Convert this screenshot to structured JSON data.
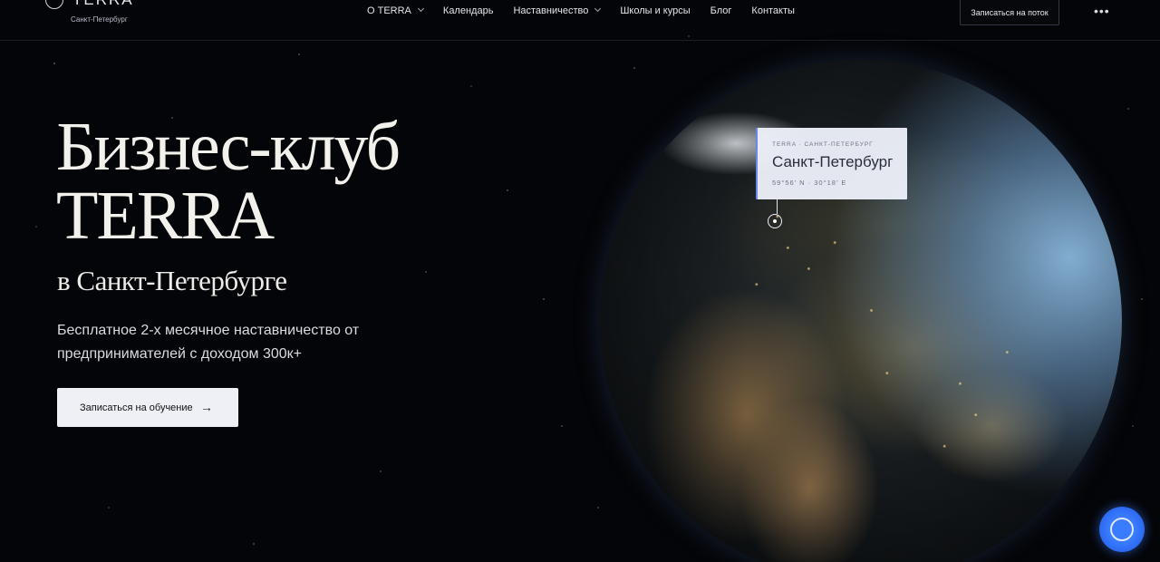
{
  "header": {
    "logo_text": "TERRA",
    "logo_sub": "Санкт-Петербург",
    "nav": [
      {
        "label": "О TERRA",
        "has_dropdown": true
      },
      {
        "label": "Календарь",
        "has_dropdown": false
      },
      {
        "label": "Наставничество",
        "has_dropdown": true
      },
      {
        "label": "Школы и курсы",
        "has_dropdown": false
      },
      {
        "label": "Блог",
        "has_dropdown": false
      },
      {
        "label": "Контакты",
        "has_dropdown": false
      }
    ],
    "cta_label": "Записаться на поток",
    "more_label": "•••"
  },
  "hero": {
    "title_line1": "Бизнес-клуб",
    "title_line2": "TERRA",
    "subtitle": "в Санкт-Петербурге",
    "description": "Бесплатное 2-х месячное наставничество от предпринимателей с доходом 300к+",
    "button_label": "Записаться на обучение",
    "button_arrow": "→"
  },
  "location_card": {
    "top": "TERRA · САНКТ-ПЕТЕРБУРГ",
    "city": "Санкт-Петербург",
    "coords": "59°56′ N · 30°18′ E"
  },
  "colors": {
    "background": "#040508",
    "accent_blue": "#3a7cff",
    "button_bg": "#eef0f6"
  }
}
